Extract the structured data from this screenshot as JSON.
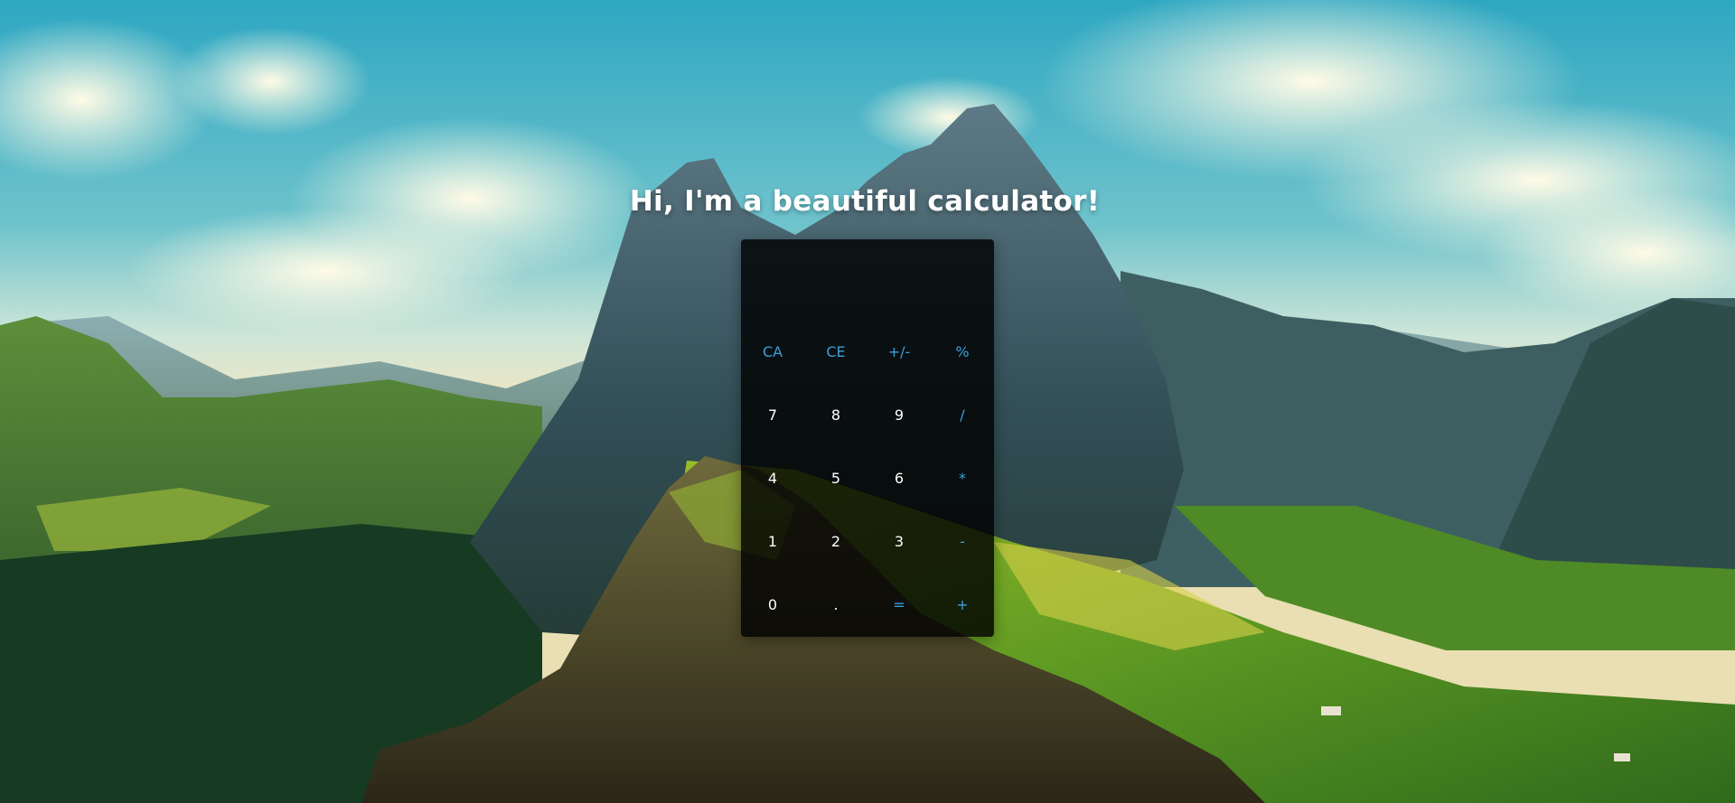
{
  "page": {
    "title": "Hi, I'm a beautiful calculator!"
  },
  "calculator": {
    "display": "",
    "keys": [
      {
        "label": "CA",
        "kind": "func",
        "name": "clear-all-button"
      },
      {
        "label": "CE",
        "kind": "func",
        "name": "clear-entry-button"
      },
      {
        "label": "+/-",
        "kind": "func",
        "name": "toggle-sign-button"
      },
      {
        "label": "%",
        "kind": "func",
        "name": "percent-button"
      },
      {
        "label": "7",
        "kind": "num",
        "name": "digit-7-button"
      },
      {
        "label": "8",
        "kind": "num",
        "name": "digit-8-button"
      },
      {
        "label": "9",
        "kind": "num",
        "name": "digit-9-button"
      },
      {
        "label": "/",
        "kind": "func",
        "name": "divide-button"
      },
      {
        "label": "4",
        "kind": "num",
        "name": "digit-4-button"
      },
      {
        "label": "5",
        "kind": "num",
        "name": "digit-5-button"
      },
      {
        "label": "6",
        "kind": "num",
        "name": "digit-6-button"
      },
      {
        "label": "*",
        "kind": "func",
        "name": "multiply-button"
      },
      {
        "label": "1",
        "kind": "num",
        "name": "digit-1-button"
      },
      {
        "label": "2",
        "kind": "num",
        "name": "digit-2-button"
      },
      {
        "label": "3",
        "kind": "num",
        "name": "digit-3-button"
      },
      {
        "label": "-",
        "kind": "func",
        "name": "subtract-button"
      },
      {
        "label": "0",
        "kind": "num",
        "name": "digit-0-button"
      },
      {
        "label": ".",
        "kind": "num",
        "name": "decimal-point-button"
      },
      {
        "label": "=",
        "kind": "func",
        "name": "equals-button"
      },
      {
        "label": "+",
        "kind": "func",
        "name": "add-button"
      }
    ]
  },
  "colors": {
    "function_key": "#3aa0dd",
    "digit_key": "#ffffff",
    "calculator_bg": "rgba(0,0,0,0.82)"
  }
}
